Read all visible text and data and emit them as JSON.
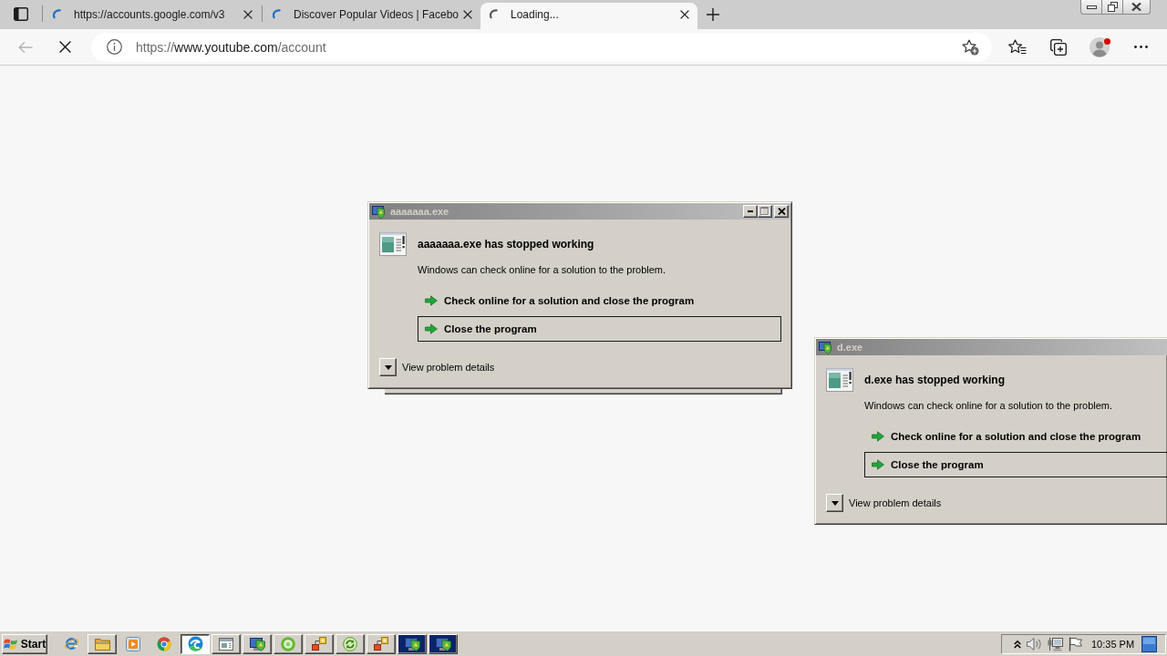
{
  "browser": {
    "tabs": [
      {
        "title": "https://accounts.google.com/v3",
        "selected": false,
        "waiting": false
      },
      {
        "title": "Discover Popular Videos | Facebo",
        "selected": false,
        "waiting": false
      },
      {
        "title": "Loading...",
        "selected": true,
        "waiting": true
      }
    ],
    "back": {
      "disabled": true
    },
    "page_loading": true,
    "address": {
      "scheme": "https://",
      "host": "www.youtube.com",
      "path": "/account"
    },
    "profile": {
      "notification": true
    }
  },
  "dialogs": [
    {
      "title": "aaaaaaa.exe",
      "active": false,
      "window_behind": true,
      "title_buttons": [
        {
          "kind": "minimize",
          "disabled": false
        },
        {
          "kind": "maximize",
          "disabled": true
        },
        {
          "kind": "close",
          "disabled": false
        }
      ],
      "heading": "aaaaaaa.exe has stopped working",
      "message": "Windows can check online for a solution to the problem.",
      "options": [
        {
          "label": "Check online for a solution and close the program",
          "focused": false
        },
        {
          "label": "Close the program",
          "focused": true
        }
      ],
      "details": {
        "label": "View problem details",
        "expanded": false
      }
    },
    {
      "title": "d.exe",
      "active": false,
      "heading": "d.exe has stopped working",
      "message": "Windows can check online for a solution to the problem.",
      "options": [
        {
          "label": "Check online for a solution and close the program",
          "focused": false
        },
        {
          "label": "Close the program",
          "focused": true
        }
      ],
      "details": {
        "label": "View problem details",
        "expanded": false
      }
    }
  ],
  "taskbar": {
    "start": "Start",
    "items": [
      {
        "kind": "explorer",
        "running": false,
        "pressed": false,
        "flashing": false
      },
      {
        "kind": "folder",
        "running": true,
        "pressed": false,
        "flashing": false
      },
      {
        "kind": "player",
        "running": false,
        "pressed": false,
        "flashing": false
      },
      {
        "kind": "chrome",
        "running": false,
        "pressed": false,
        "flashing": false
      },
      {
        "kind": "edge",
        "running": true,
        "pressed": true,
        "flashing": false
      },
      {
        "kind": "window",
        "running": true,
        "pressed": false,
        "flashing": false
      },
      {
        "kind": "app",
        "running": true,
        "pressed": false,
        "flashing": false
      },
      {
        "kind": "ring",
        "running": true,
        "pressed": false,
        "flashing": false
      },
      {
        "kind": "network",
        "running": true,
        "pressed": false,
        "flashing": false
      },
      {
        "kind": "arrows",
        "running": true,
        "pressed": false,
        "flashing": false
      },
      {
        "kind": "network",
        "running": true,
        "pressed": false,
        "flashing": false
      },
      {
        "kind": "app",
        "running": true,
        "pressed": false,
        "flashing": true
      },
      {
        "kind": "app",
        "running": true,
        "pressed": false,
        "flashing": true
      }
    ],
    "clock": "10:35 PM"
  }
}
